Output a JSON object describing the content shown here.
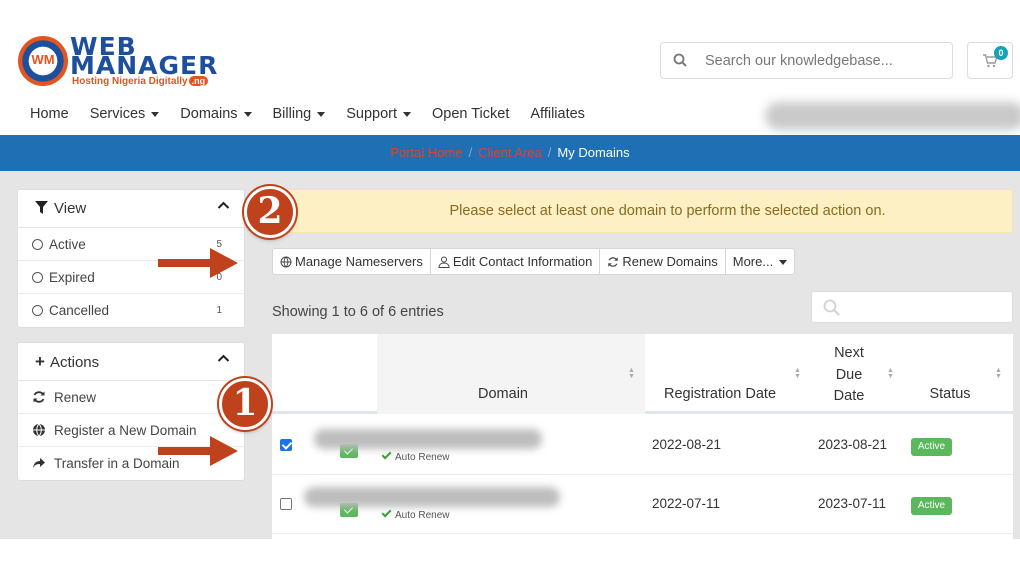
{
  "logo": {
    "badge": "WM",
    "line1": "WEB",
    "line2": "MANAGER",
    "tagline": "Hosting Nigeria Digitally",
    "tag_suffix": ".ng"
  },
  "search": {
    "placeholder": "Search our knowledgebase..."
  },
  "cart": {
    "count": "0"
  },
  "nav": {
    "items": [
      "Home",
      "Services",
      "Domains",
      "Billing",
      "Support",
      "Open Ticket",
      "Affiliates"
    ]
  },
  "breadcrumb": {
    "home": "Portal Home",
    "client_area": "Client Area",
    "current": "My Domains"
  },
  "sidebar": {
    "view": {
      "title": "View",
      "items": [
        {
          "label": "Active",
          "count": "5"
        },
        {
          "label": "Expired",
          "count": "0"
        },
        {
          "label": "Cancelled",
          "count": "1"
        }
      ]
    },
    "actions": {
      "title": "Actions",
      "items": [
        {
          "label": "Renew"
        },
        {
          "label": "Register a New Domain"
        },
        {
          "label": "Transfer in a Domain"
        }
      ]
    }
  },
  "alert": {
    "text": "Please select at least one domain to perform the selected action on."
  },
  "toolbar": {
    "manage_ns": "Manage Nameservers",
    "edit_contact": "Edit Contact Information",
    "renew": "Renew Domains",
    "more": "More..."
  },
  "table": {
    "showing": "Showing 1 to 6 of 6 entries",
    "headers": {
      "domain": "Domain",
      "reg_date": "Registration Date",
      "next_due_1": "Next",
      "next_due_2": "Due",
      "next_due_3": "Date",
      "status": "Status"
    },
    "rows": [
      {
        "checked": true,
        "auto_renew": "Auto Renew",
        "reg_date": "2022-08-21",
        "due_date": "2023-08-21",
        "status": "Active"
      },
      {
        "checked": false,
        "auto_renew": "Auto Renew",
        "reg_date": "2022-07-11",
        "due_date": "2023-07-11",
        "status": "Active"
      }
    ]
  },
  "annotations": {
    "step1": "1",
    "step2": "2"
  },
  "colors": {
    "brand_blue": "#1d4f9c",
    "brand_orange": "#e2551f",
    "breadcrumb_bar": "#1e6fb3",
    "status_green": "#5cb85c",
    "annotation": "#c0421c"
  }
}
